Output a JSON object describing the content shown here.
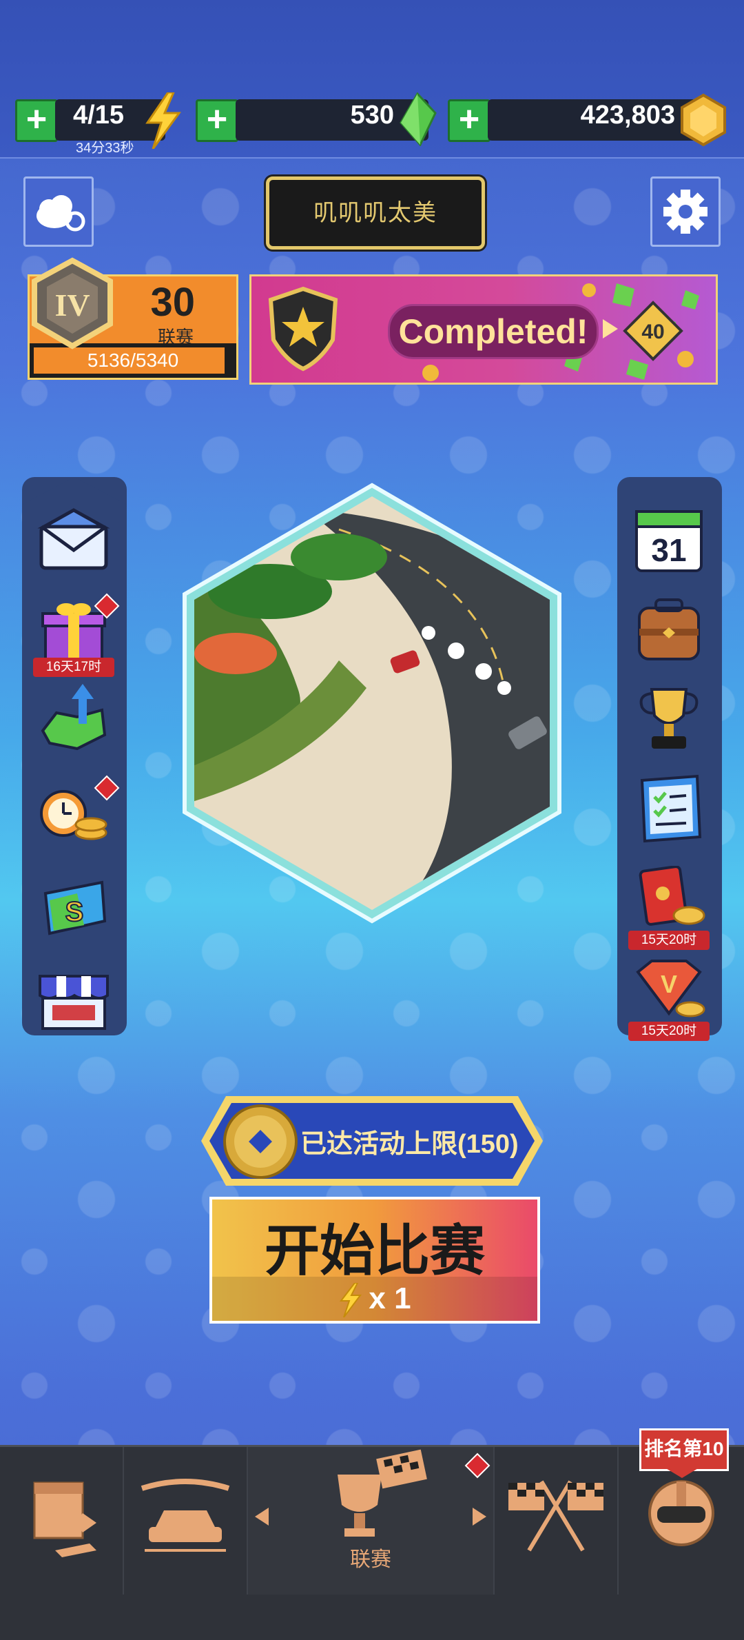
{
  "topbar": {
    "energy": {
      "value": "4/15",
      "timer": "34分33秒"
    },
    "gems": {
      "value": "530"
    },
    "coins": {
      "value": "423,803"
    },
    "plus_symbol": "+"
  },
  "header": {
    "player_name": "叽叽叽太美",
    "cloud_icon": "cloud-sync-icon",
    "settings_icon": "gear-icon"
  },
  "league": {
    "rank_roman": "IV",
    "level": "30",
    "label": "联赛",
    "progress_text": "5136/5340",
    "progress": 0.962
  },
  "banner": {
    "status": "Completed!",
    "reward": "40"
  },
  "left_menu": {
    "items": [
      {
        "name": "mail-icon"
      },
      {
        "name": "gift-icon",
        "timer": "16天17时",
        "badge": true
      },
      {
        "name": "gem-upgrade-icon"
      },
      {
        "name": "clock-coins-icon",
        "badge": true
      },
      {
        "name": "s-card-icon"
      },
      {
        "name": "shop-icon"
      }
    ]
  },
  "right_menu": {
    "items": [
      {
        "name": "calendar-icon",
        "day": "31"
      },
      {
        "name": "backpack-icon"
      },
      {
        "name": "trophy-icon"
      },
      {
        "name": "checklist-icon"
      },
      {
        "name": "red-envelope-icon",
        "timer": "15天20时"
      },
      {
        "name": "v-gem-icon",
        "timer": "15天20时"
      }
    ]
  },
  "event": {
    "limit_text": "已达活动上限(150)"
  },
  "start": {
    "label": "开始比赛",
    "cost": "x 1"
  },
  "bottom_nav": {
    "tabs": [
      {
        "name": "crates-tab"
      },
      {
        "name": "garage-tab"
      },
      {
        "name": "league-tab",
        "label": "联赛",
        "badge": true
      },
      {
        "name": "race-flags-tab"
      },
      {
        "name": "profile-tab"
      }
    ],
    "rank_badge": "排名第10"
  },
  "colors": {
    "accent_gold": "#f1d27a",
    "energy_yellow": "#ffd23a",
    "start_orange": "#f19b3d",
    "alert_red": "#d92a30"
  }
}
